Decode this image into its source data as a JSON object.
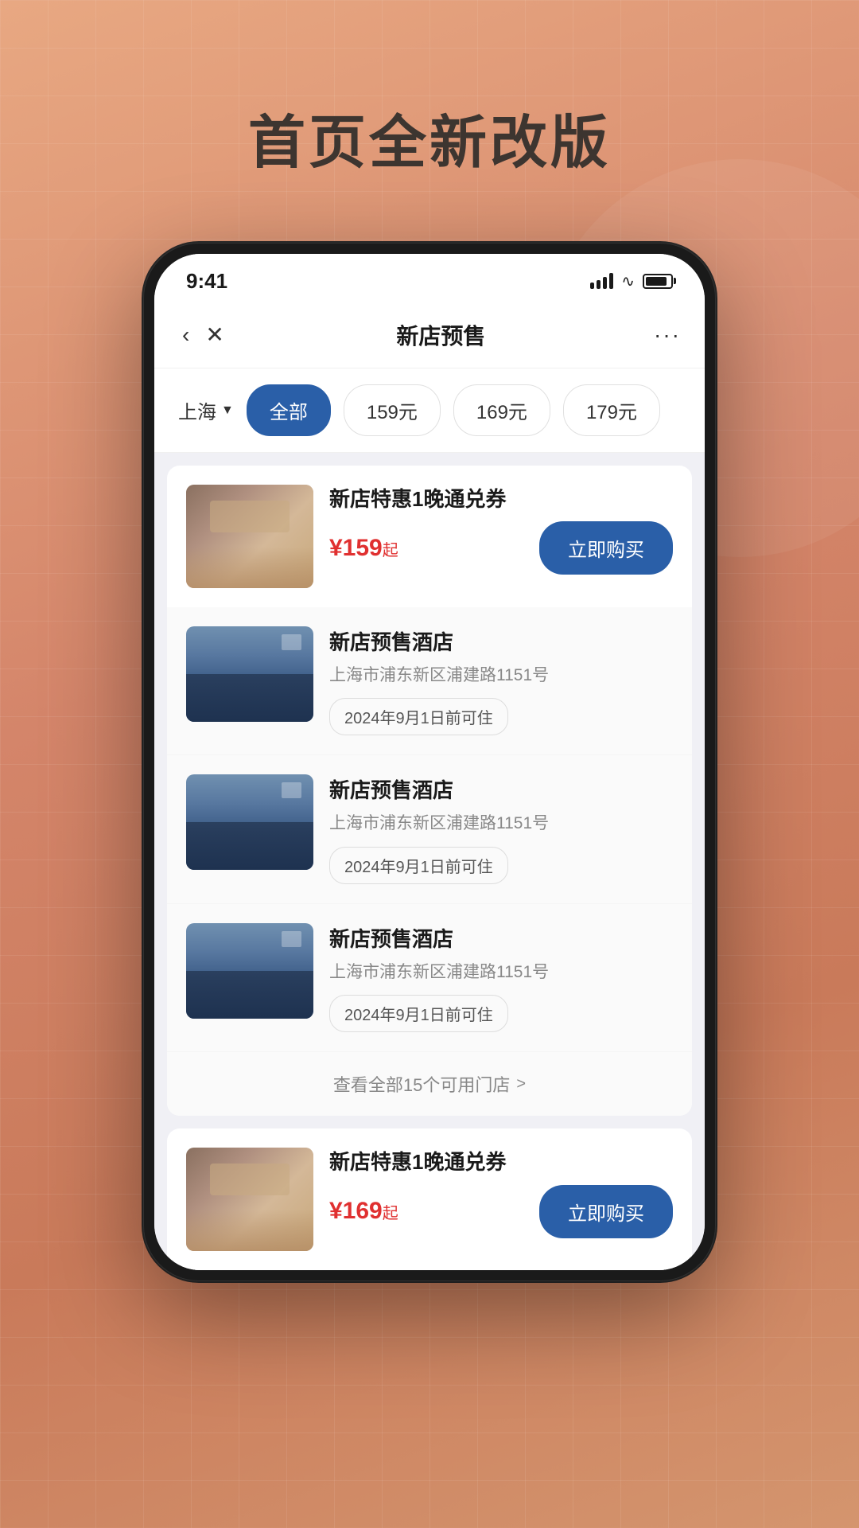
{
  "page": {
    "headline": "首页全新改版"
  },
  "statusBar": {
    "time": "9:41"
  },
  "nav": {
    "title": "新店预售",
    "more": "···"
  },
  "filters": {
    "city": "上海",
    "options": [
      {
        "label": "全部",
        "active": true
      },
      {
        "label": "159元",
        "active": false
      },
      {
        "label": "169元",
        "active": false
      },
      {
        "label": "179元",
        "active": false
      }
    ]
  },
  "cards": [
    {
      "id": "card-1",
      "type": "product",
      "title": "新店特惠1晚通兑券",
      "price": "¥159",
      "priceSuffix": "起",
      "buyLabel": "立即购买",
      "hotels": [
        {
          "name": "新店预售酒店",
          "address": "上海市浦东新区浦建路1151号",
          "dateTag": "2024年9月1日前可住"
        },
        {
          "name": "新店预售酒店",
          "address": "上海市浦东新区浦建路1151号",
          "dateTag": "2024年9月1日前可住"
        },
        {
          "name": "新店预售酒店",
          "address": "上海市浦东新区浦建路1151号",
          "dateTag": "2024年9月1日前可住"
        }
      ],
      "viewAllText": "查看全部15个可用门店",
      "viewAllArrow": ">"
    },
    {
      "id": "card-2",
      "type": "product",
      "title": "新店特惠1晚通兑券",
      "price": "¥169",
      "priceSuffix": "起",
      "buyLabel": "立即购买"
    }
  ]
}
